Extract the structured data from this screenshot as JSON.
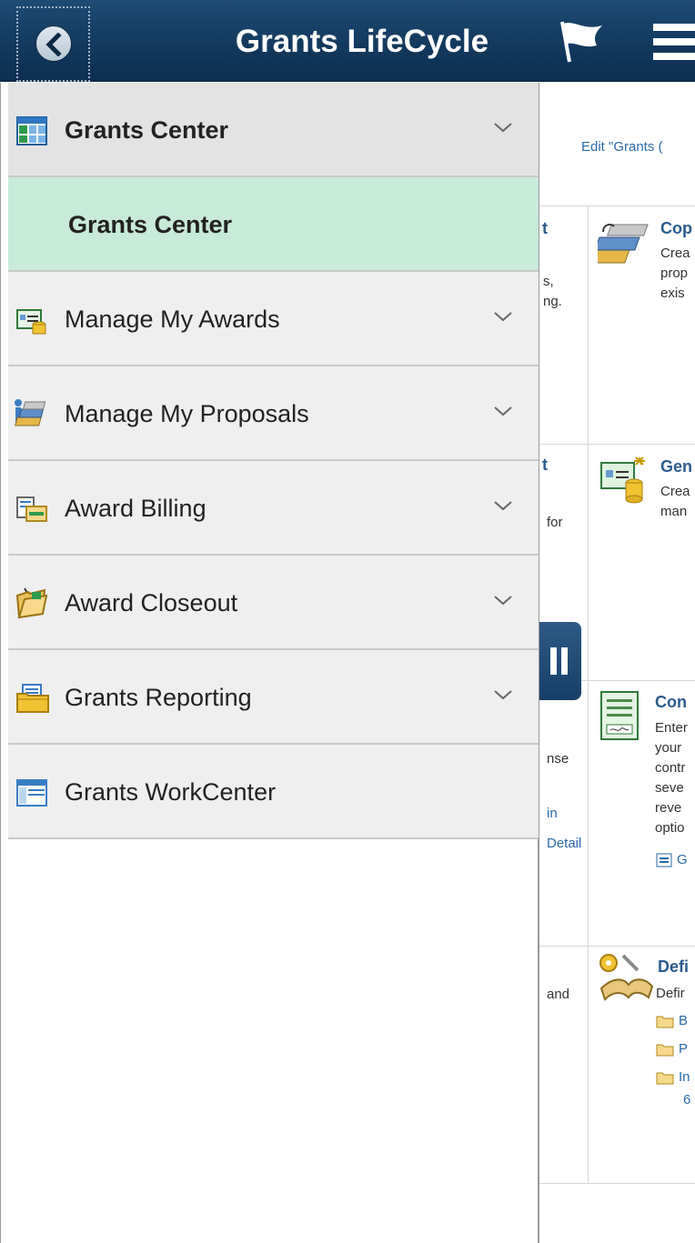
{
  "header": {
    "title": "Grants LifeCycle",
    "back_icon": "chevron-left-icon",
    "flag_icon": "flag-icon",
    "menu_icon": "hamburger-icon"
  },
  "sidenav": {
    "items": [
      {
        "label": "Grants Center",
        "icon": "grid-report-icon",
        "expandable": true,
        "state": "expanded"
      },
      {
        "label": "Grants Center",
        "icon": "",
        "expandable": false,
        "state": "selected"
      },
      {
        "label": "Manage My Awards",
        "icon": "award-card-icon",
        "expandable": true
      },
      {
        "label": "Manage My Proposals",
        "icon": "proposal-books-icon",
        "expandable": true
      },
      {
        "label": "Award Billing",
        "icon": "billing-icon",
        "expandable": true
      },
      {
        "label": "Award Closeout",
        "icon": "folder-open-icon",
        "expandable": true
      },
      {
        "label": "Grants Reporting",
        "icon": "report-folder-icon",
        "expandable": true
      },
      {
        "label": "Grants WorkCenter",
        "icon": "workcenter-window-icon",
        "expandable": false
      }
    ]
  },
  "background": {
    "edit_link": "Edit \"Grants (",
    "tile1": {
      "frag_title": "t",
      "frag_text": [
        "s,",
        "ng."
      ]
    },
    "tile2": {
      "title": "Cop",
      "lines": [
        "Crea",
        "prop",
        "exis"
      ]
    },
    "tile3": {
      "frag_title": "t",
      "frag_text": [
        "for"
      ]
    },
    "tile4": {
      "title": "Gen",
      "lines": [
        "Crea",
        "man"
      ]
    },
    "tile5": {
      "frag_text": [
        "nse"
      ],
      "frag_links": [
        "in",
        "Detail"
      ]
    },
    "tile6": {
      "title": "Con",
      "lines": [
        "Enter",
        "your",
        "contr",
        "seve",
        "reve",
        "optio"
      ],
      "link": "G"
    },
    "tile7": {
      "frag_text": [
        "and"
      ]
    },
    "tile8": {
      "title": "Defi",
      "lines": [
        "Defir"
      ],
      "folders": [
        "B",
        "P",
        "In"
      ],
      "extra": "6"
    },
    "pause_icon": "pause-icon"
  }
}
